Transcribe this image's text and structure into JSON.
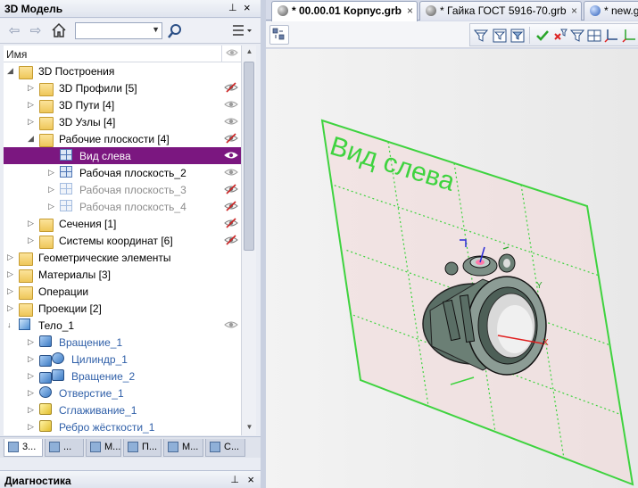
{
  "left_panel": {
    "title": "3D Модель",
    "pin_glyph": "⊥",
    "close_glyph": "×",
    "column_header": "Имя",
    "tree": [
      {
        "label": "3D Построения",
        "level": 0,
        "toggle": "◢",
        "icon": "folder-icon",
        "visibility": "none"
      },
      {
        "label": "3D Профили [5]",
        "level": 1,
        "toggle": "▷",
        "icon": "folder-icon",
        "visibility": "hidden"
      },
      {
        "label": "3D Пути [4]",
        "level": 1,
        "toggle": "▷",
        "icon": "folder-icon",
        "visibility": "visible"
      },
      {
        "label": "3D Узлы [4]",
        "level": 1,
        "toggle": "▷",
        "icon": "folder-icon",
        "visibility": "visible"
      },
      {
        "label": "Рабочие плоскости [4]",
        "level": 1,
        "toggle": "◢",
        "icon": "folder-icon",
        "visibility": "hidden"
      },
      {
        "label": "Вид слева",
        "level": 2,
        "toggle": "",
        "icon": "plane-icon",
        "visibility": "visible",
        "selected": true
      },
      {
        "label": "Рабочая плоскость_2",
        "level": 2,
        "toggle": "▷",
        "icon": "plane-icon",
        "visibility": "visible"
      },
      {
        "label": "Рабочая плоскость_3",
        "level": 2,
        "toggle": "▷",
        "icon": "plane-icon",
        "visibility": "hidden",
        "dim": true
      },
      {
        "label": "Рабочая плоскость_4",
        "level": 2,
        "toggle": "▷",
        "icon": "plane-icon",
        "visibility": "hidden",
        "dim": true
      },
      {
        "label": "Сечения [1]",
        "level": 1,
        "toggle": "▷",
        "icon": "folder-icon",
        "visibility": "hidden"
      },
      {
        "label": "Системы координат [6]",
        "level": 1,
        "toggle": "▷",
        "icon": "folder-icon",
        "visibility": "hidden"
      },
      {
        "label": "Геометрические элементы",
        "level": 0,
        "toggle": "▷",
        "icon": "folder-icon",
        "visibility": "none"
      },
      {
        "label": "Материалы [3]",
        "level": 0,
        "toggle": "▷",
        "icon": "folder-icon",
        "visibility": "none"
      },
      {
        "label": "Операции",
        "level": 0,
        "toggle": "▷",
        "icon": "folder-icon",
        "visibility": "none"
      },
      {
        "label": "Проекции [2]",
        "level": 0,
        "toggle": "▷",
        "icon": "folder-icon",
        "visibility": "none"
      },
      {
        "label": "Тело_1",
        "level": 0,
        "toggle": "↓",
        "icon": "body-icon",
        "visibility": "visible"
      },
      {
        "label": "Вращение_1",
        "level": 1,
        "toggle": "▷",
        "icon": "revolve-icon",
        "visibility": "none",
        "blue": true
      },
      {
        "label": "Цилиндр_1",
        "level": 1,
        "toggle": "▷",
        "icon": "cylinder-icon",
        "visibility": "none",
        "blue": true,
        "extra_icon": true
      },
      {
        "label": "Вращение_2",
        "level": 1,
        "toggle": "▷",
        "icon": "revolve-icon",
        "visibility": "none",
        "blue": true,
        "extra_icon": true
      },
      {
        "label": "Отверстие_1",
        "level": 1,
        "toggle": "▷",
        "icon": "hole-icon",
        "visibility": "none",
        "blue": true
      },
      {
        "label": "Сглаживание_1",
        "level": 1,
        "toggle": "▷",
        "icon": "fillet-icon",
        "visibility": "none",
        "blue": true
      },
      {
        "label": "Ребро жёсткости_1",
        "level": 1,
        "toggle": "▷",
        "icon": "rib-icon",
        "visibility": "none",
        "blue": true
      }
    ],
    "bottom_tabs": [
      {
        "label": "3...",
        "active": true
      },
      {
        "label": "...",
        "active": false
      },
      {
        "label": "М...",
        "active": false
      },
      {
        "label": "П...",
        "active": false
      },
      {
        "label": "М...",
        "active": false
      },
      {
        "label": "С...",
        "active": false
      }
    ],
    "diagnostics_title": "Диагностика"
  },
  "doc_tabs": [
    {
      "label": "* 00.00.01 Корпус.grb",
      "active": true,
      "close": "×"
    },
    {
      "label": "* Гайка ГОСТ 5916-70.grb",
      "active": false,
      "close": "×"
    },
    {
      "label": "* new.g",
      "active": false,
      "close": ""
    }
  ],
  "viewport": {
    "plane_label": "Вид слева",
    "axis_y": "Y",
    "axis_x": "X",
    "plane_color": "#3fd33f",
    "selection_color": "#7b1780"
  }
}
